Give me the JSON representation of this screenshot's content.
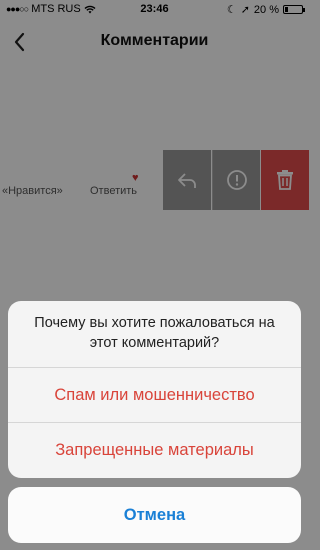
{
  "status": {
    "carrier": "MTS RUS",
    "time": "23:46",
    "battery": "20 %"
  },
  "nav": {
    "title": "Комментарии"
  },
  "comment": {
    "like_label": "«Нравится»",
    "reply_label": "Ответить"
  },
  "sheet": {
    "message": "Почему вы хотите пожаловаться на этот комментарий?",
    "options": [
      "Спам или мошенничество",
      "Запрещенные материалы"
    ],
    "cancel": "Отмена"
  },
  "colors": {
    "destructive": "#d9443a",
    "cancel": "#1a80d6",
    "delete_action": "#e04b4b",
    "action_gray": "#9a9a9a"
  }
}
